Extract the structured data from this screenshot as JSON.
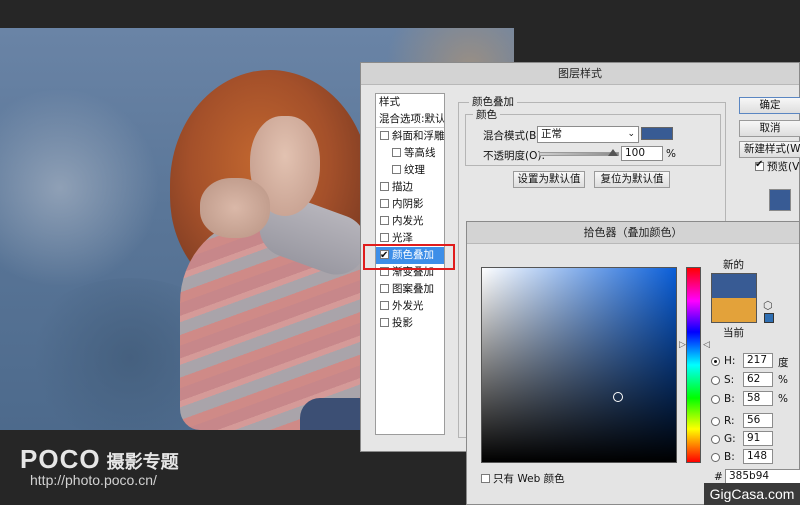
{
  "layer_style": {
    "title": "图层样式",
    "style_items": [
      {
        "label": "样式",
        "type": "header"
      },
      {
        "label": "混合选项:默认",
        "type": "header"
      },
      {
        "label": "斜面和浮雕",
        "checked": false
      },
      {
        "label": "等高线",
        "checked": false,
        "sub": true
      },
      {
        "label": "纹理",
        "checked": false,
        "sub": true
      },
      {
        "label": "描边",
        "checked": false
      },
      {
        "label": "内阴影",
        "checked": false
      },
      {
        "label": "内发光",
        "checked": false
      },
      {
        "label": "光泽",
        "checked": false
      },
      {
        "label": "颜色叠加",
        "checked": true,
        "selected": true
      },
      {
        "label": "渐变叠加",
        "checked": false
      },
      {
        "label": "图案叠加",
        "checked": false
      },
      {
        "label": "外发光",
        "checked": false
      },
      {
        "label": "投影",
        "checked": false
      }
    ],
    "group_title": "颜色叠加",
    "subgroup_title": "颜色",
    "blend_mode_label": "混合模式(B):",
    "blend_mode_value": "正常",
    "overlay_color": "#385b94",
    "opacity_label": "不透明度(O):",
    "opacity_value": "100",
    "opacity_unit": "%",
    "set_default_label": "设置为默认值",
    "reset_default_label": "复位为默认值",
    "ok_label": "确定",
    "cancel_label": "取消",
    "new_style_label": "新建样式(W)...",
    "preview_label": "预览(V)",
    "preview_checked": true
  },
  "color_picker": {
    "title": "拾色器（叠加颜色）",
    "new_label": "新的",
    "current_label": "当前",
    "new_color": "#385b94",
    "current_color": "#e3a23a",
    "fields": {
      "H": {
        "label": "H:",
        "value": "217",
        "unit": "度",
        "selected": true
      },
      "S": {
        "label": "S:",
        "value": "62",
        "unit": "%"
      },
      "Bv": {
        "label": "B:",
        "value": "58",
        "unit": "%"
      },
      "R": {
        "label": "R:",
        "value": "56"
      },
      "G": {
        "label": "G:",
        "value": "91"
      },
      "Bb": {
        "label": "B:",
        "value": "148"
      }
    },
    "hex_label": "#",
    "hex_value": "385b94",
    "web_only_label": "只有 Web 颜色"
  },
  "watermark": {
    "logo": "POCO",
    "logo_cn": "摄影专题",
    "url": "http://photo.poco.cn/",
    "site": "GigCasa.com"
  }
}
